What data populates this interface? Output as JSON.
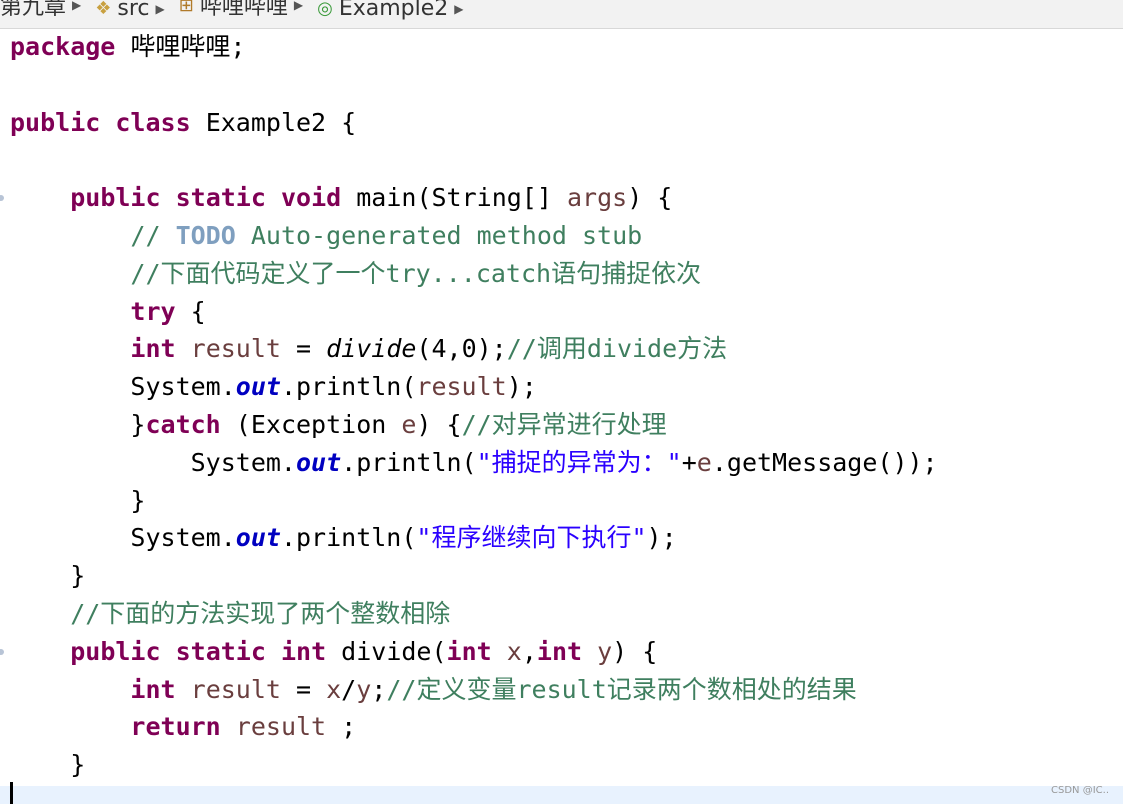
{
  "breadcrumb": {
    "items": [
      {
        "label": "第九章",
        "icon": "package-folder-icon"
      },
      {
        "label": "src",
        "icon": "source-folder-icon"
      },
      {
        "label": "哔哩哔哩",
        "icon": "package-icon"
      },
      {
        "label": "Example2",
        "icon": "class-icon"
      }
    ]
  },
  "code": {
    "lines": [
      {
        "tokens": [
          {
            "t": "package",
            "c": "kw"
          },
          {
            "t": " 哔哩哔哩;",
            "c": ""
          }
        ]
      },
      {
        "tokens": []
      },
      {
        "tokens": [
          {
            "t": "public",
            "c": "kw"
          },
          {
            "t": " ",
            "c": ""
          },
          {
            "t": "class",
            "c": "kw"
          },
          {
            "t": " Example2 {",
            "c": ""
          }
        ]
      },
      {
        "tokens": []
      },
      {
        "tokens": [
          {
            "t": "    ",
            "c": ""
          },
          {
            "t": "public",
            "c": "kw"
          },
          {
            "t": " ",
            "c": ""
          },
          {
            "t": "static",
            "c": "kw"
          },
          {
            "t": " ",
            "c": ""
          },
          {
            "t": "void",
            "c": "kw"
          },
          {
            "t": " main(String[] ",
            "c": ""
          },
          {
            "t": "args",
            "c": "var"
          },
          {
            "t": ") {",
            "c": ""
          }
        ],
        "marker": true
      },
      {
        "tokens": [
          {
            "t": "        // ",
            "c": "cm"
          },
          {
            "t": "TODO",
            "c": "todo"
          },
          {
            "t": " Auto-generated method stub",
            "c": "cm"
          }
        ]
      },
      {
        "tokens": [
          {
            "t": "        //下面代码定义了一个try...catch语句捕捉依次",
            "c": "cm"
          }
        ]
      },
      {
        "tokens": [
          {
            "t": "        ",
            "c": ""
          },
          {
            "t": "try",
            "c": "kw"
          },
          {
            "t": " {",
            "c": ""
          }
        ]
      },
      {
        "tokens": [
          {
            "t": "        ",
            "c": ""
          },
          {
            "t": "int",
            "c": "kw"
          },
          {
            "t": " ",
            "c": ""
          },
          {
            "t": "result",
            "c": "var"
          },
          {
            "t": " = ",
            "c": ""
          },
          {
            "t": "divide",
            "c": "it"
          },
          {
            "t": "(4,0);",
            "c": ""
          },
          {
            "t": "//调用divide方法",
            "c": "cm"
          }
        ]
      },
      {
        "tokens": [
          {
            "t": "        System.",
            "c": ""
          },
          {
            "t": "out",
            "c": "fld"
          },
          {
            "t": ".println(",
            "c": ""
          },
          {
            "t": "result",
            "c": "var"
          },
          {
            "t": ");",
            "c": ""
          }
        ]
      },
      {
        "tokens": [
          {
            "t": "        }",
            "c": ""
          },
          {
            "t": "catch",
            "c": "kw"
          },
          {
            "t": " (Exception ",
            "c": ""
          },
          {
            "t": "e",
            "c": "var"
          },
          {
            "t": ") {",
            "c": ""
          },
          {
            "t": "//对异常进行处理",
            "c": "cm"
          }
        ]
      },
      {
        "tokens": [
          {
            "t": "            System.",
            "c": ""
          },
          {
            "t": "out",
            "c": "fld"
          },
          {
            "t": ".println(",
            "c": ""
          },
          {
            "t": "\"捕捉的异常为：\"",
            "c": "str"
          },
          {
            "t": "+",
            "c": ""
          },
          {
            "t": "e",
            "c": "var"
          },
          {
            "t": ".getMessage());",
            "c": ""
          }
        ]
      },
      {
        "tokens": [
          {
            "t": "        }",
            "c": ""
          }
        ]
      },
      {
        "tokens": [
          {
            "t": "        System.",
            "c": ""
          },
          {
            "t": "out",
            "c": "fld"
          },
          {
            "t": ".println(",
            "c": ""
          },
          {
            "t": "\"程序继续向下执行\"",
            "c": "str"
          },
          {
            "t": ");",
            "c": ""
          }
        ]
      },
      {
        "tokens": [
          {
            "t": "    }",
            "c": ""
          }
        ]
      },
      {
        "tokens": [
          {
            "t": "    //下面的方法实现了两个整数相除",
            "c": "cm"
          }
        ]
      },
      {
        "tokens": [
          {
            "t": "    ",
            "c": ""
          },
          {
            "t": "public",
            "c": "kw"
          },
          {
            "t": " ",
            "c": ""
          },
          {
            "t": "static",
            "c": "kw"
          },
          {
            "t": " ",
            "c": ""
          },
          {
            "t": "int",
            "c": "kw"
          },
          {
            "t": " divide(",
            "c": ""
          },
          {
            "t": "int",
            "c": "kw"
          },
          {
            "t": " ",
            "c": ""
          },
          {
            "t": "x",
            "c": "var"
          },
          {
            "t": ",",
            "c": ""
          },
          {
            "t": "int",
            "c": "kw"
          },
          {
            "t": " ",
            "c": ""
          },
          {
            "t": "y",
            "c": "var"
          },
          {
            "t": ") {",
            "c": ""
          }
        ],
        "marker": true
      },
      {
        "tokens": [
          {
            "t": "        ",
            "c": ""
          },
          {
            "t": "int",
            "c": "kw"
          },
          {
            "t": " ",
            "c": ""
          },
          {
            "t": "result",
            "c": "var"
          },
          {
            "t": " = ",
            "c": ""
          },
          {
            "t": "x",
            "c": "var"
          },
          {
            "t": "/",
            "c": ""
          },
          {
            "t": "y",
            "c": "var"
          },
          {
            "t": ";",
            "c": ""
          },
          {
            "t": "//定义变量result记录两个数相处的结果",
            "c": "cm"
          }
        ]
      },
      {
        "tokens": [
          {
            "t": "        ",
            "c": ""
          },
          {
            "t": "return",
            "c": "kw"
          },
          {
            "t": " ",
            "c": ""
          },
          {
            "t": "result",
            "c": "var"
          },
          {
            "t": " ;",
            "c": ""
          }
        ]
      },
      {
        "tokens": [
          {
            "t": "    }",
            "c": ""
          }
        ]
      }
    ]
  },
  "watermark": "CSDN @IC.."
}
